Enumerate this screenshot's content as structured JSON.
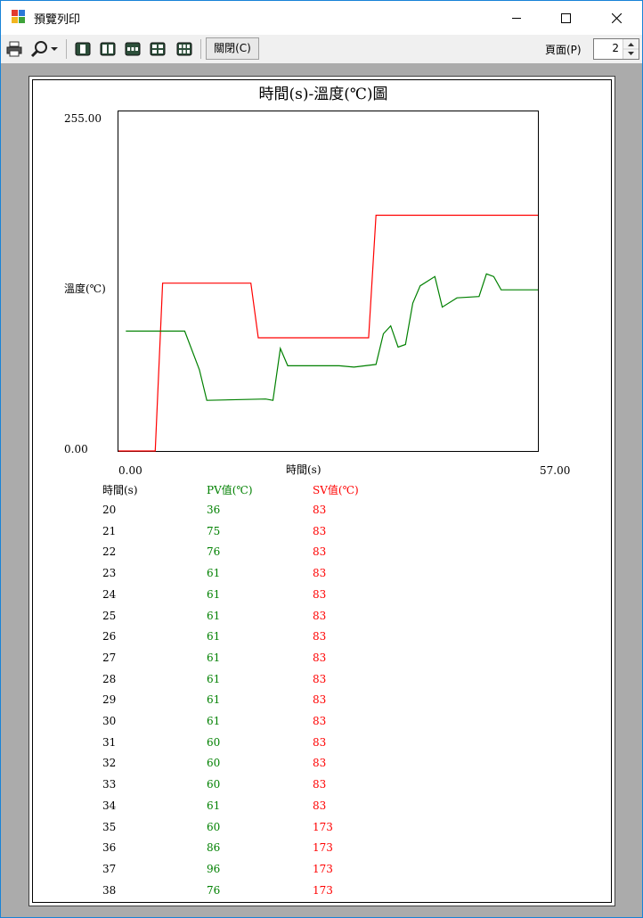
{
  "window": {
    "title": "預覽列印",
    "controls": [
      "minimize-icon",
      "maximize-icon",
      "close-icon"
    ]
  },
  "toolbar": {
    "icons": [
      "print-icon",
      "zoom-icon",
      "chevron-down-icon",
      "one-page-icon",
      "two-pages-icon",
      "three-pages-icon",
      "four-pages-icon",
      "six-pages-icon"
    ],
    "close_label": "關閉(C)",
    "page_label": "頁面(P)",
    "page_value": "2"
  },
  "chart_data": {
    "type": "line",
    "title": "時間(s)-溫度(℃)圖",
    "xlabel": "時間(s)",
    "ylabel": "溫度(℃)",
    "xlim": [
      0,
      57
    ],
    "ylim": [
      0,
      255
    ],
    "x_tick_labels": [
      "0.00",
      "57.00"
    ],
    "y_tick_labels": [
      "0.00",
      "255.00"
    ],
    "grid": false,
    "series": [
      {
        "color": "#ff0000",
        "x": [
          0,
          5,
          6,
          18,
          19,
          34,
          35,
          57
        ],
        "y": [
          0,
          0,
          126,
          126,
          85,
          85,
          177,
          177
        ]
      },
      {
        "color": "#008000",
        "x": [
          1,
          9,
          11,
          12,
          20,
          21,
          22,
          23,
          30,
          32,
          35,
          36,
          37,
          38,
          39,
          40,
          41,
          43,
          44,
          46,
          49,
          50,
          51,
          52,
          57
        ],
        "y": [
          90,
          90,
          61,
          38,
          39,
          38,
          77,
          64,
          64,
          63,
          65,
          88,
          94,
          78,
          80,
          111,
          124,
          131,
          108,
          115,
          116,
          133,
          131,
          121,
          121
        ]
      }
    ]
  },
  "table": {
    "headers": {
      "time": "時間(s)",
      "pv": "PV值(℃)",
      "sv": "SV值(℃)"
    },
    "header_colors": {
      "time": "#000000",
      "pv": "#008000",
      "sv": "#ff0000"
    },
    "rows": [
      {
        "time": "20",
        "pv": "36",
        "sv": "83"
      },
      {
        "time": "21",
        "pv": "75",
        "sv": "83"
      },
      {
        "time": "22",
        "pv": "76",
        "sv": "83"
      },
      {
        "time": "23",
        "pv": "61",
        "sv": "83"
      },
      {
        "time": "24",
        "pv": "61",
        "sv": "83"
      },
      {
        "time": "25",
        "pv": "61",
        "sv": "83"
      },
      {
        "time": "26",
        "pv": "61",
        "sv": "83"
      },
      {
        "time": "27",
        "pv": "61",
        "sv": "83"
      },
      {
        "time": "28",
        "pv": "61",
        "sv": "83"
      },
      {
        "time": "29",
        "pv": "61",
        "sv": "83"
      },
      {
        "time": "30",
        "pv": "61",
        "sv": "83"
      },
      {
        "time": "31",
        "pv": "60",
        "sv": "83"
      },
      {
        "time": "32",
        "pv": "60",
        "sv": "83"
      },
      {
        "time": "33",
        "pv": "60",
        "sv": "83"
      },
      {
        "time": "34",
        "pv": "61",
        "sv": "83"
      },
      {
        "time": "35",
        "pv": "60",
        "sv": "173"
      },
      {
        "time": "36",
        "pv": "86",
        "sv": "173"
      },
      {
        "time": "37",
        "pv": "96",
        "sv": "173"
      },
      {
        "time": "38",
        "pv": "76",
        "sv": "173"
      }
    ]
  },
  "colors": {
    "viewport_bg": "#ababab",
    "toolbar_bg": "#f0f0f0",
    "pv": "#008000",
    "sv": "#ff0000"
  }
}
